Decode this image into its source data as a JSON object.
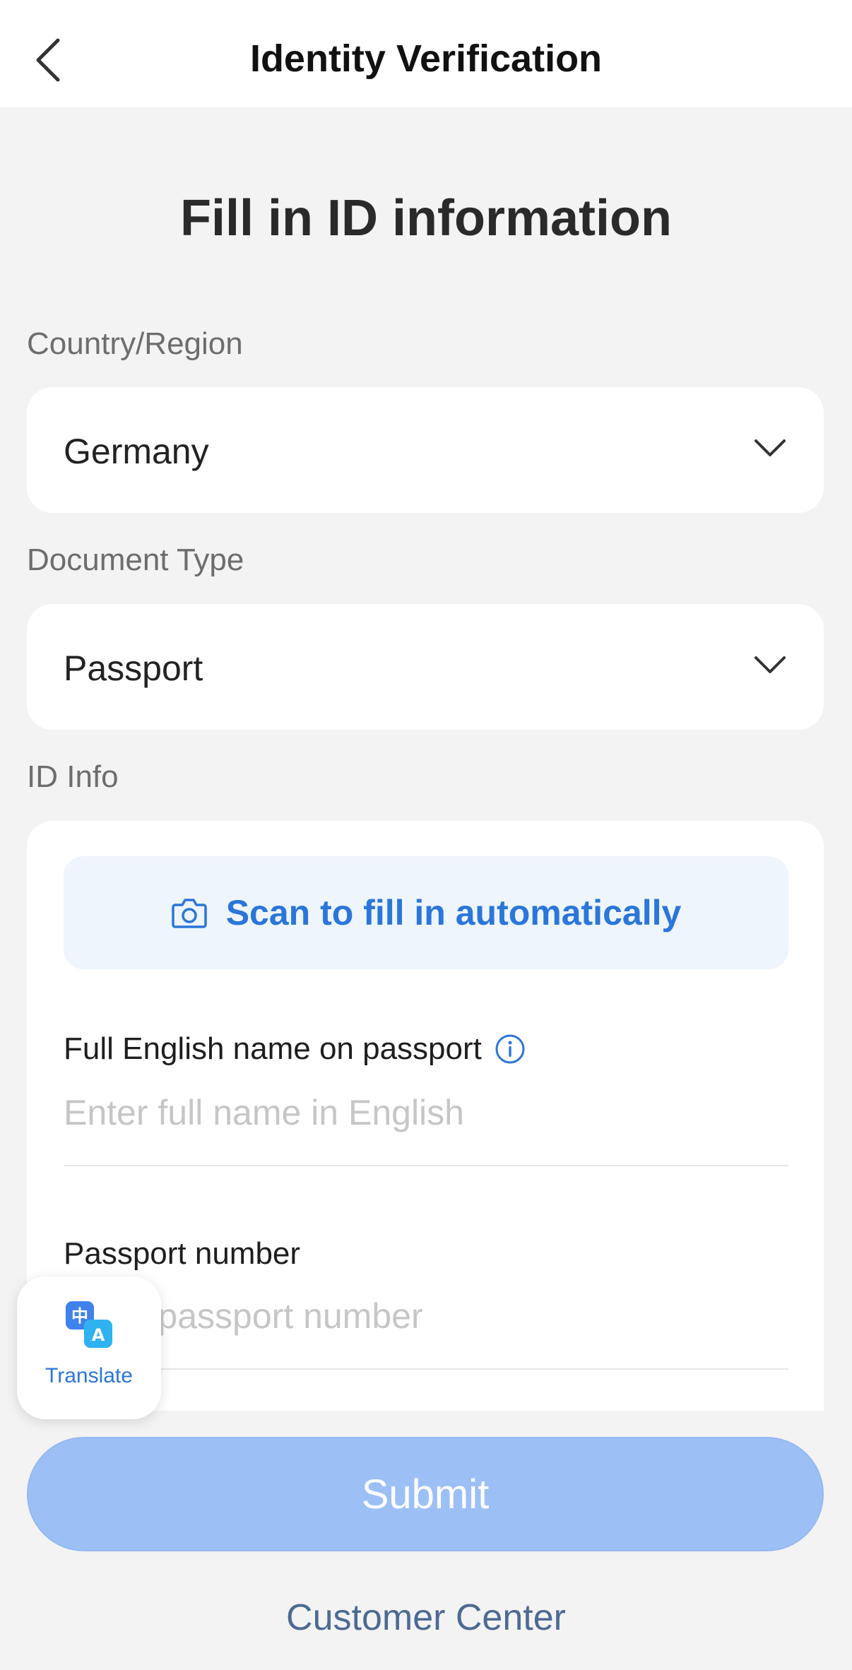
{
  "header": {
    "title": "Identity Verification",
    "back_icon": "chevron-left-icon"
  },
  "page_heading": "Fill in ID information",
  "country": {
    "label": "Country/Region",
    "value": "Germany",
    "icon": "chevron-down-icon"
  },
  "document_type": {
    "label": "Document Type",
    "value": "Passport",
    "icon": "chevron-down-icon"
  },
  "id_info": {
    "label": "ID Info",
    "scan_button": {
      "label": "Scan to fill in automatically",
      "icon": "camera-icon"
    },
    "full_name": {
      "label": "Full English name on passport",
      "placeholder": "Enter full name in English",
      "info_icon": "info-icon"
    },
    "passport_number": {
      "label": "Passport number",
      "placeholder": "Enter passport number"
    }
  },
  "translate": {
    "label": "Translate",
    "icon": "translate-icon"
  },
  "submit": {
    "label": "Submit"
  },
  "customer_center": {
    "label": "Customer Center"
  },
  "colors": {
    "accent": "#2b76da",
    "submit_disabled": "#9cc0f6",
    "background": "#f3f3f4",
    "link": "#4d6a91"
  }
}
